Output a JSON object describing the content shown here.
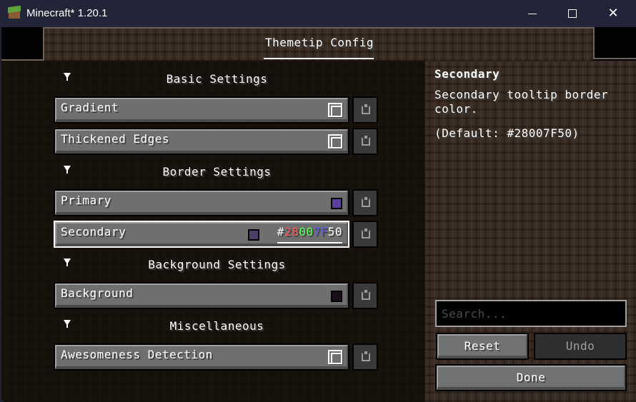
{
  "window": {
    "title": "Minecraft* 1.20.1",
    "icon": "grass-block-icon",
    "controls": {
      "minimize": "minimize-icon",
      "maximize": "maximize-icon",
      "close": "close-icon",
      "close_glyph": "✕"
    }
  },
  "screen": {
    "title": "Themetip Config"
  },
  "categories": [
    {
      "label": "Basic Settings",
      "entries": [
        {
          "label": "Gradient",
          "type": "boolean",
          "value": true
        },
        {
          "label": "Thickened Edges",
          "type": "boolean",
          "value": true
        }
      ]
    },
    {
      "label": "Border Settings",
      "entries": [
        {
          "label": "Primary",
          "type": "color",
          "swatch": "#5A3F9E"
        },
        {
          "label": "Secondary",
          "type": "color",
          "swatch": "#4E3F6A",
          "editing": true,
          "hex_value": {
            "prefix": "#",
            "red": "28",
            "green": "00",
            "blue": "7F",
            "alpha": "50",
            "colors": {
              "prefix": "#ffffff",
              "red": "#ff5555",
              "green": "#55ff55",
              "blue": "#5555ff",
              "alpha": "#ffffff"
            }
          }
        }
      ]
    },
    {
      "label": "Background Settings",
      "entries": [
        {
          "label": "Background",
          "type": "color",
          "swatch": "#1a0f1a"
        }
      ]
    },
    {
      "label": "Miscellaneous",
      "entries": [
        {
          "label": "Awesomeness Detection",
          "type": "boolean",
          "value": true
        }
      ]
    }
  ],
  "info_panel": {
    "title": "Secondary",
    "description": "Secondary tooltip border color.",
    "default": "(Default: #28007F50)"
  },
  "search": {
    "placeholder": "Search...",
    "value": ""
  },
  "buttons": {
    "reset": "Reset",
    "undo": "Undo",
    "done": "Done"
  },
  "icons": {
    "collapse": "collapse-arrow-icon",
    "reset_entry": "reset-icon"
  }
}
